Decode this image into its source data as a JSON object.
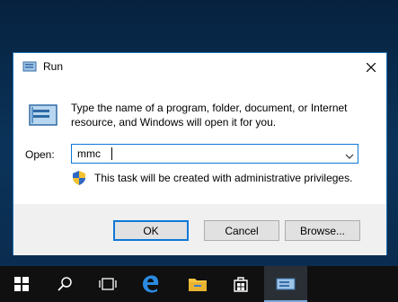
{
  "dialog": {
    "title": "Run",
    "description": "Type the name of a program, folder, document, or Internet resource, and Windows will open it for you.",
    "open_label": "Open:",
    "open_value": "mmc",
    "admin_notice": "This task will be created with administrative privileges.",
    "buttons": {
      "ok": "OK",
      "cancel": "Cancel",
      "browse": "Browse..."
    }
  },
  "taskbar": {
    "items": [
      "start-icon",
      "search-icon",
      "task-view-icon",
      "edge-icon",
      "file-explorer-icon",
      "store-icon",
      "run-app-icon"
    ],
    "active": "run-app-icon"
  },
  "colors": {
    "accent": "#0f78d6",
    "taskbar": "#101010",
    "desktop": "#0b3359"
  }
}
